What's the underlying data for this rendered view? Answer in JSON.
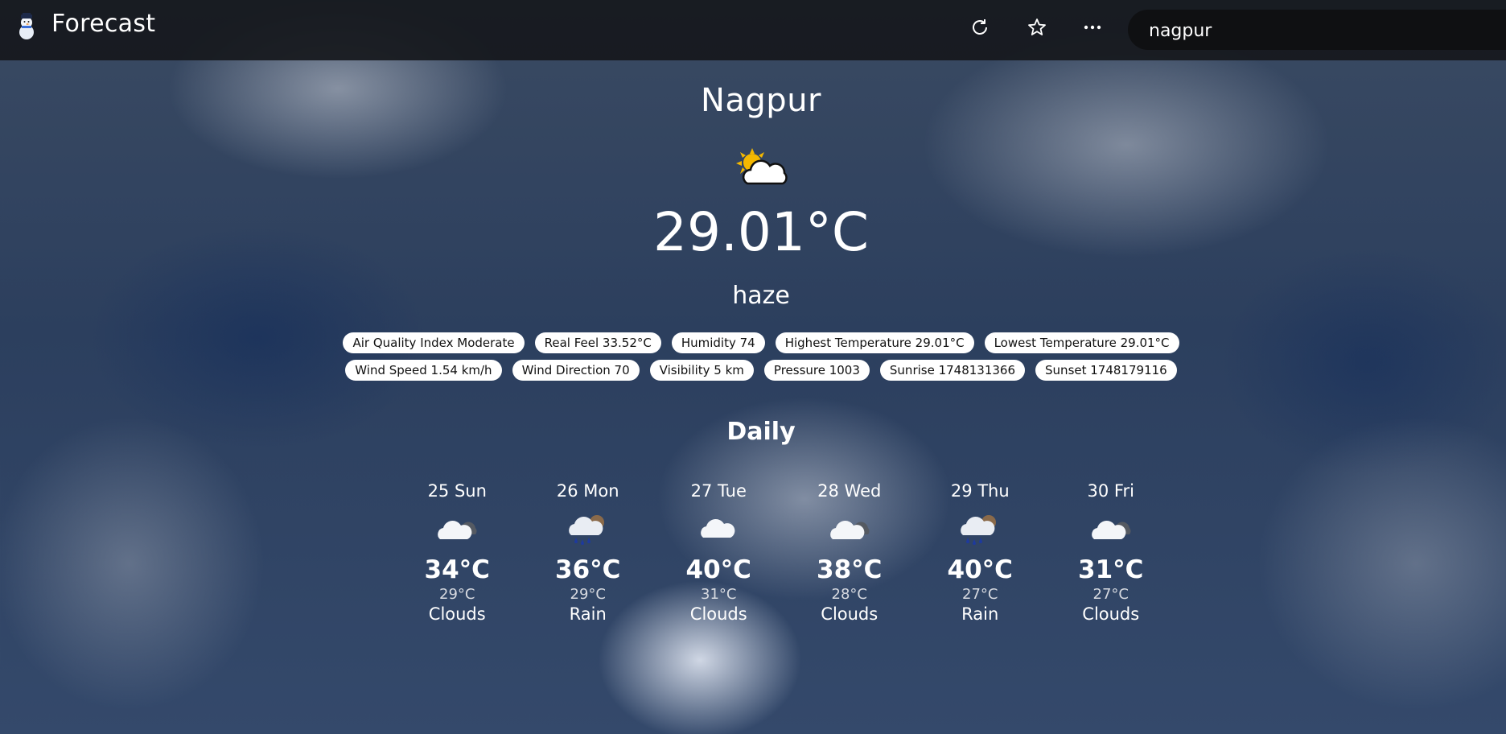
{
  "app": {
    "title": "Forecast",
    "logo_icon": "snowman-icon"
  },
  "toolbar": {
    "refresh_icon": "refresh-icon",
    "favorite_icon": "star-icon",
    "more_icon": "more-dots-icon"
  },
  "search": {
    "value": "nagpur"
  },
  "current": {
    "city": "Nagpur",
    "icon": "sun-behind-cloud-icon",
    "temperature": "29.01",
    "unit": "°C",
    "description": "haze"
  },
  "details_row1": [
    "Air Quality Index Moderate",
    "Real Feel 33.52°C",
    "Humidity 74",
    "Highest Temperature 29.01°C",
    "Lowest Temperature 29.01°C"
  ],
  "details_row2": [
    "Wind Speed 1.54 km/h",
    "Wind Direction 70",
    "Visibility 5 km",
    "Pressure 1003",
    "Sunrise 1748131366",
    "Sunset 1748179116"
  ],
  "daily": {
    "title": "Daily",
    "days": [
      {
        "date": "25 Sun",
        "icon": "cloud-icon",
        "high": "34°C",
        "low": "29°C",
        "condition": "Clouds"
      },
      {
        "date": "26 Mon",
        "icon": "rain-cloud-icon",
        "high": "36°C",
        "low": "29°C",
        "condition": "Rain"
      },
      {
        "date": "27 Tue",
        "icon": "cloud-icon",
        "high": "40°C",
        "low": "31°C",
        "condition": "Clouds"
      },
      {
        "date": "28 Wed",
        "icon": "cloud-icon",
        "high": "38°C",
        "low": "28°C",
        "condition": "Clouds"
      },
      {
        "date": "29 Thu",
        "icon": "rain-cloud-icon",
        "high": "40°C",
        "low": "27°C",
        "condition": "Rain"
      },
      {
        "date": "30 Fri",
        "icon": "cloud-icon",
        "high": "31°C",
        "low": "27°C",
        "condition": "Clouds"
      }
    ]
  },
  "colors": {
    "topbar": "#16181c",
    "chip_bg": "#ffffff",
    "chip_text": "#111111",
    "text": "#ffffff"
  }
}
